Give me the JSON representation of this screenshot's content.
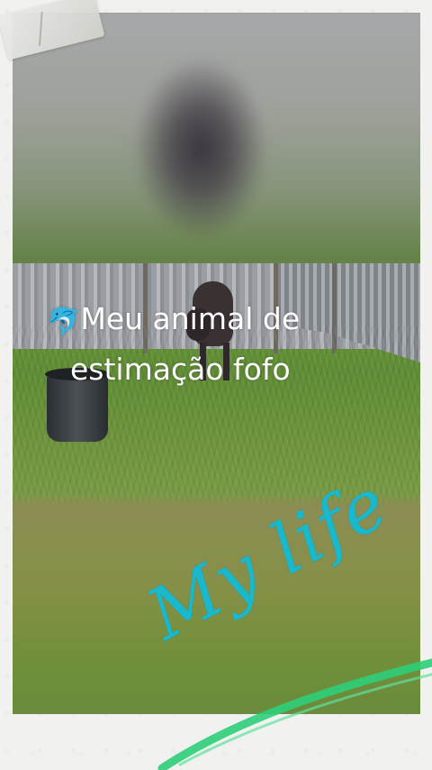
{
  "caption": {
    "emoji": "🐬",
    "line1": "Meu animal de",
    "line2": "estimação fofo"
  },
  "handwriting": {
    "text": "My life",
    "color": "#19b8cc"
  },
  "accents": {
    "stroke_color": "#2fce7a"
  }
}
